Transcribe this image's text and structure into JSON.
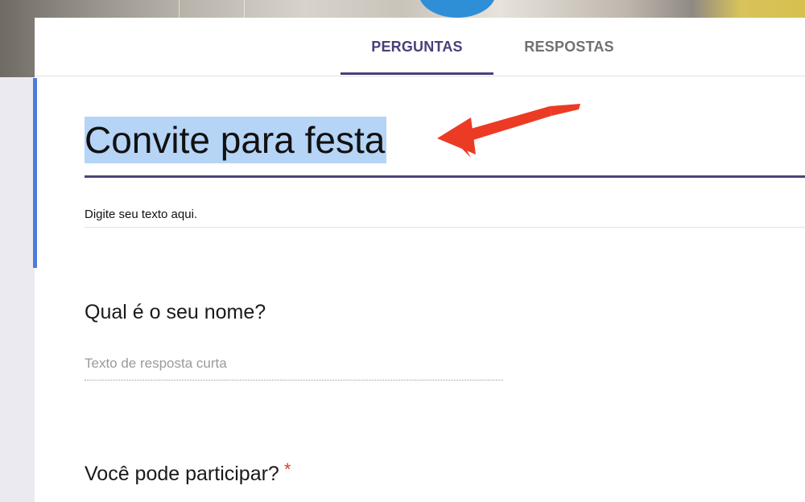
{
  "tabs": {
    "questions": "PERGUNTAS",
    "responses": "RESPOSTAS"
  },
  "form": {
    "title": "Convite para festa",
    "description": "Digite seu texto aqui."
  },
  "questions": [
    {
      "text": "Qual é o seu nome?",
      "answer_placeholder": "Texto de resposta curta"
    },
    {
      "text": "Você pode participar?",
      "required_mark": "*"
    }
  ],
  "colors": {
    "tab_active": "#4b3f79",
    "title_highlight": "#b5d4f6",
    "accent": "#4d7cd9",
    "arrow": "#ec3b25",
    "required": "#d23f31"
  }
}
